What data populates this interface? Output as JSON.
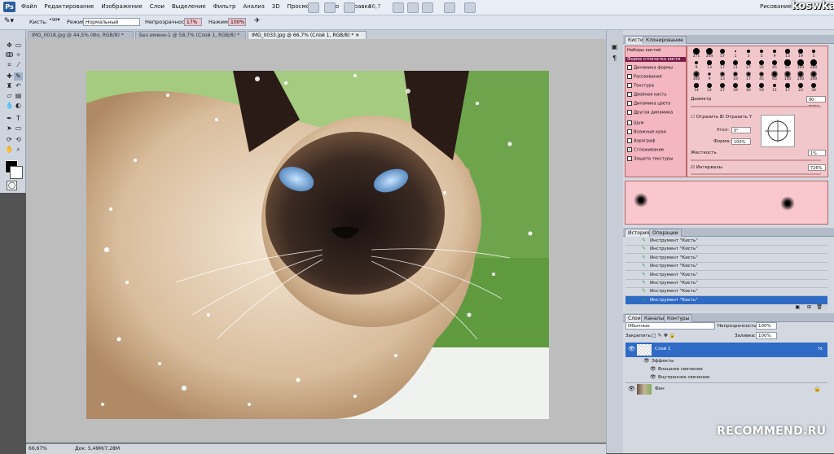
{
  "app": {
    "brand": "koswka",
    "workspace": "Рисование",
    "zoom_display": "66,7"
  },
  "menu": [
    "Файл",
    "Редактирование",
    "Изображение",
    "Слои",
    "Выделение",
    "Фильтр",
    "Анализ",
    "3D",
    "Просмотр",
    "Окно",
    "Справка"
  ],
  "options_bar": {
    "brush_label": "Кисть:",
    "brush_size": "90",
    "mode_label": "Режим:",
    "mode_value": "Нормальный",
    "opacity_label": "Непрозрачность:",
    "opacity_value": "17%",
    "pressure_label": "Нажим:",
    "pressure_value": "100%"
  },
  "doc_tabs": [
    {
      "label": "IMG_0018.jpg @ 44,5% (Фо, RGB/8) *",
      "active": false
    },
    {
      "label": "Без имени-1 @ 58,7% (Слой 1, RGB/8) *",
      "active": false
    },
    {
      "label": "IMG_0033.jpg @ 66,7% (Слой 1, RGB/8) *",
      "active": true
    }
  ],
  "status": {
    "zoom": "66,67%",
    "doc": "Док: 5,49M/7,28M"
  },
  "brush_panel": {
    "tabs": [
      "Кисти",
      "Клонирование"
    ],
    "presets_label": "Наборы кистей",
    "items": [
      {
        "label": "Форма отпечатка кисти",
        "checked": null,
        "highlight": true
      },
      {
        "label": "Динамика формы",
        "checked": false
      },
      {
        "label": "Рассеивание",
        "checked": false
      },
      {
        "label": "Текстура",
        "checked": false
      },
      {
        "label": "Двойная кисть",
        "checked": false
      },
      {
        "label": "Динамика цвета",
        "checked": false
      },
      {
        "label": "Другая динамика",
        "checked": false
      },
      {
        "label": "Шум",
        "checked": false
      },
      {
        "label": "Влажные края",
        "checked": false
      },
      {
        "label": "Аэрограф",
        "checked": false
      },
      {
        "label": "Сглаживание",
        "checked": true
      },
      {
        "label": "Защита текстуры",
        "checked": false
      }
    ],
    "tip_sizes_row1": [
      "271",
      "204",
      "57",
      "1",
      "3",
      "5",
      "9",
      "13",
      "19",
      "5"
    ],
    "tip_sizes_row2": [
      "9",
      "13",
      "17",
      "21",
      "27",
      "35",
      "45",
      "65",
      "100",
      "200"
    ],
    "tip_sizes_row3": [
      "300",
      "9",
      "13",
      "19",
      "17",
      "45",
      "65",
      "100",
      "200",
      "300"
    ],
    "tip_sizes_row4": [
      "14",
      "24",
      "27",
      "39",
      "46",
      "59",
      "11",
      "17",
      "23",
      "36"
    ],
    "diameter_label": "Диаметр",
    "diameter_value": "90 пикс.",
    "flip_x": "Отразить X",
    "flip_y": "Отразить Y",
    "angle_label": "Угол:",
    "angle_value": "0°",
    "roundness_label": "Форма:",
    "roundness_value": "100%",
    "hardness_label": "Жесткость",
    "hardness_value": "1%",
    "spacing_label": "Интервалы",
    "spacing_value": "726%"
  },
  "history_panel": {
    "tabs": [
      "История",
      "Операции"
    ],
    "rows": [
      "Инструмент \"Кисть\"",
      "Инструмент \"Кисть\"",
      "Инструмент \"Кисть\"",
      "Инструмент \"Кисть\"",
      "Инструмент \"Кисть\"",
      "Инструмент \"Кисть\"",
      "Инструмент \"Кисть\"",
      "Инструмент \"Кисть\""
    ],
    "selected_index": 7
  },
  "layers_panel": {
    "tabs": [
      "Слои",
      "Каналы",
      "Контуры"
    ],
    "blend_mode": "Обычные",
    "opacity_label": "Непрозрачность:",
    "opacity_value": "100%",
    "lock_label": "Закрепить:",
    "fill_label": "Заливка:",
    "fill_value": "100%",
    "layers": [
      {
        "name": "Слой 1",
        "selected": true
      },
      {
        "name": "Эффекты",
        "selected": false
      },
      {
        "name": "Внешнее свечение",
        "selected": false
      },
      {
        "name": "Внутреннее свечение",
        "selected": false
      },
      {
        "name": "Фон",
        "selected": false
      }
    ]
  },
  "watermark": "RECOMMEND.RU"
}
